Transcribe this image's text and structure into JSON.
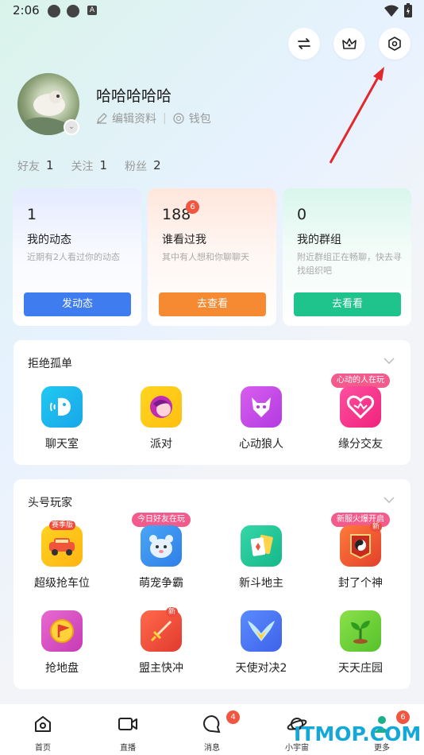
{
  "status_bar": {
    "time": "2:06",
    "notif_icon": "A"
  },
  "profile": {
    "username": "哈哈哈哈哈",
    "edit_profile": "编辑资料",
    "wallet": "钱包"
  },
  "stats": [
    {
      "label": "好友",
      "value": "1"
    },
    {
      "label": "关注",
      "value": "1"
    },
    {
      "label": "粉丝",
      "value": "2"
    }
  ],
  "cards": [
    {
      "num": "1",
      "title": "我的动态",
      "desc": "近期有2人看过你的动态",
      "button": "发动态",
      "badge": "",
      "color": "#3f7cf0"
    },
    {
      "num": "188",
      "title": "谁看过我",
      "desc": "其中有人想和你聊聊天",
      "button": "去查看",
      "badge": "6",
      "color": "#f58a32"
    },
    {
      "num": "0",
      "title": "我的群组",
      "desc": "附近群组正在畅聊，快去寻找组织吧",
      "button": "去看看",
      "color": "#1fc48d"
    }
  ],
  "section1": {
    "title": "拒绝孤单",
    "apps": [
      {
        "label": "聊天室",
        "icon": "chat-room-icon",
        "pill": ""
      },
      {
        "label": "派对",
        "icon": "party-icon",
        "pill": ""
      },
      {
        "label": "心动狼人",
        "icon": "werewolf-icon",
        "pill": ""
      },
      {
        "label": "缘分交友",
        "icon": "heart-match-icon",
        "pill": "心动的人在玩"
      }
    ]
  },
  "section2": {
    "title": "头号玩家",
    "apps": [
      {
        "label": "超级抢车位",
        "icon": "car-icon",
        "pill": "",
        "tag": "赛季版"
      },
      {
        "label": "萌宠争霸",
        "icon": "pet-icon",
        "pill": "今日好友在玩",
        "tag": ""
      },
      {
        "label": "新斗地主",
        "icon": "cards-icon",
        "pill": "",
        "tag": ""
      },
      {
        "label": "封了个神",
        "icon": "god-icon",
        "pill": "新服火爆开启",
        "tag": "新"
      },
      {
        "label": "抢地盘",
        "icon": "territory-icon",
        "pill": "",
        "tag": ""
      },
      {
        "label": "盟主快冲",
        "icon": "sword-icon",
        "pill": "",
        "tag": "新"
      },
      {
        "label": "天使对决2",
        "icon": "angel-wings-icon",
        "pill": "",
        "tag": ""
      },
      {
        "label": "天天庄园",
        "icon": "farm-sprout-icon",
        "pill": "",
        "tag": ""
      }
    ]
  },
  "nav": [
    {
      "label": "首页",
      "badge": ""
    },
    {
      "label": "直播",
      "badge": ""
    },
    {
      "label": "消息",
      "badge": "4"
    },
    {
      "label": "小宇宙",
      "badge": ""
    },
    {
      "label": "更多",
      "badge": "6"
    }
  ],
  "watermark": "ITMOP.COM"
}
